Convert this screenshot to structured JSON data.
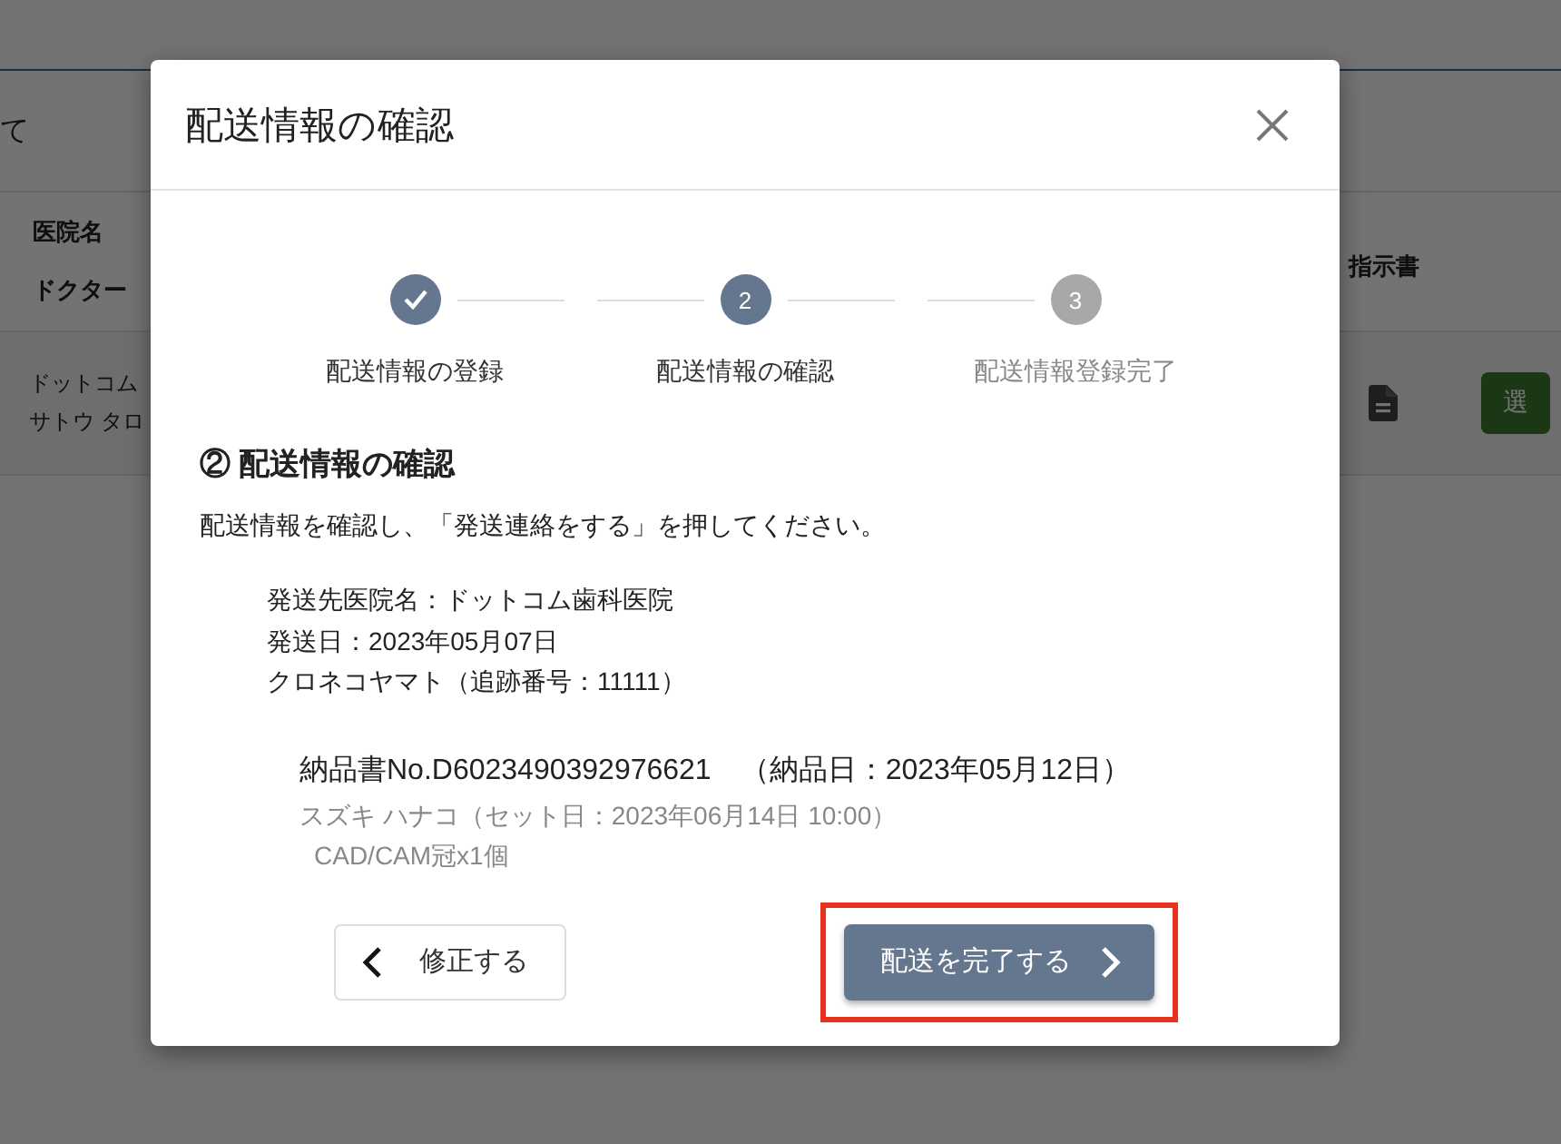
{
  "background": {
    "heading": "て",
    "columns": [
      {
        "label": "医院名"
      },
      {
        "label": "ドクター"
      },
      {
        "label": "指示書"
      }
    ],
    "rows": [
      {
        "clinic": "ドットコム",
        "doctor": "サトウ タロ",
        "button": "選"
      }
    ]
  },
  "modal": {
    "title": "配送情報の確認",
    "steps": [
      {
        "kind": "done",
        "label": "配送情報の登録"
      },
      {
        "kind": "current",
        "number": "2",
        "label": "配送情報の確認"
      },
      {
        "kind": "upcoming",
        "number": "3",
        "label": "配送情報登録完了"
      }
    ],
    "section_title": "② 配送情報の確認",
    "instruction": "配送情報を確認し、「発送連絡をする」を押してください。",
    "details": [
      "発送先医院名：ドットコム歯科医院",
      "発送日：2023年05月07日",
      "クロネコヤマト（追跡番号：11111）"
    ],
    "delivery": {
      "slip": "納品書No.D6023490392976621　（納品日：2023年05月12日）",
      "patient": "スズキ ハナコ（セット日：2023年06月14日 10:00）",
      "item": "CAD/CAM冠x1個"
    },
    "back_button": {
      "label": "修正する"
    },
    "next_button": {
      "label": "配送を完了する",
      "highlighted": true
    }
  }
}
